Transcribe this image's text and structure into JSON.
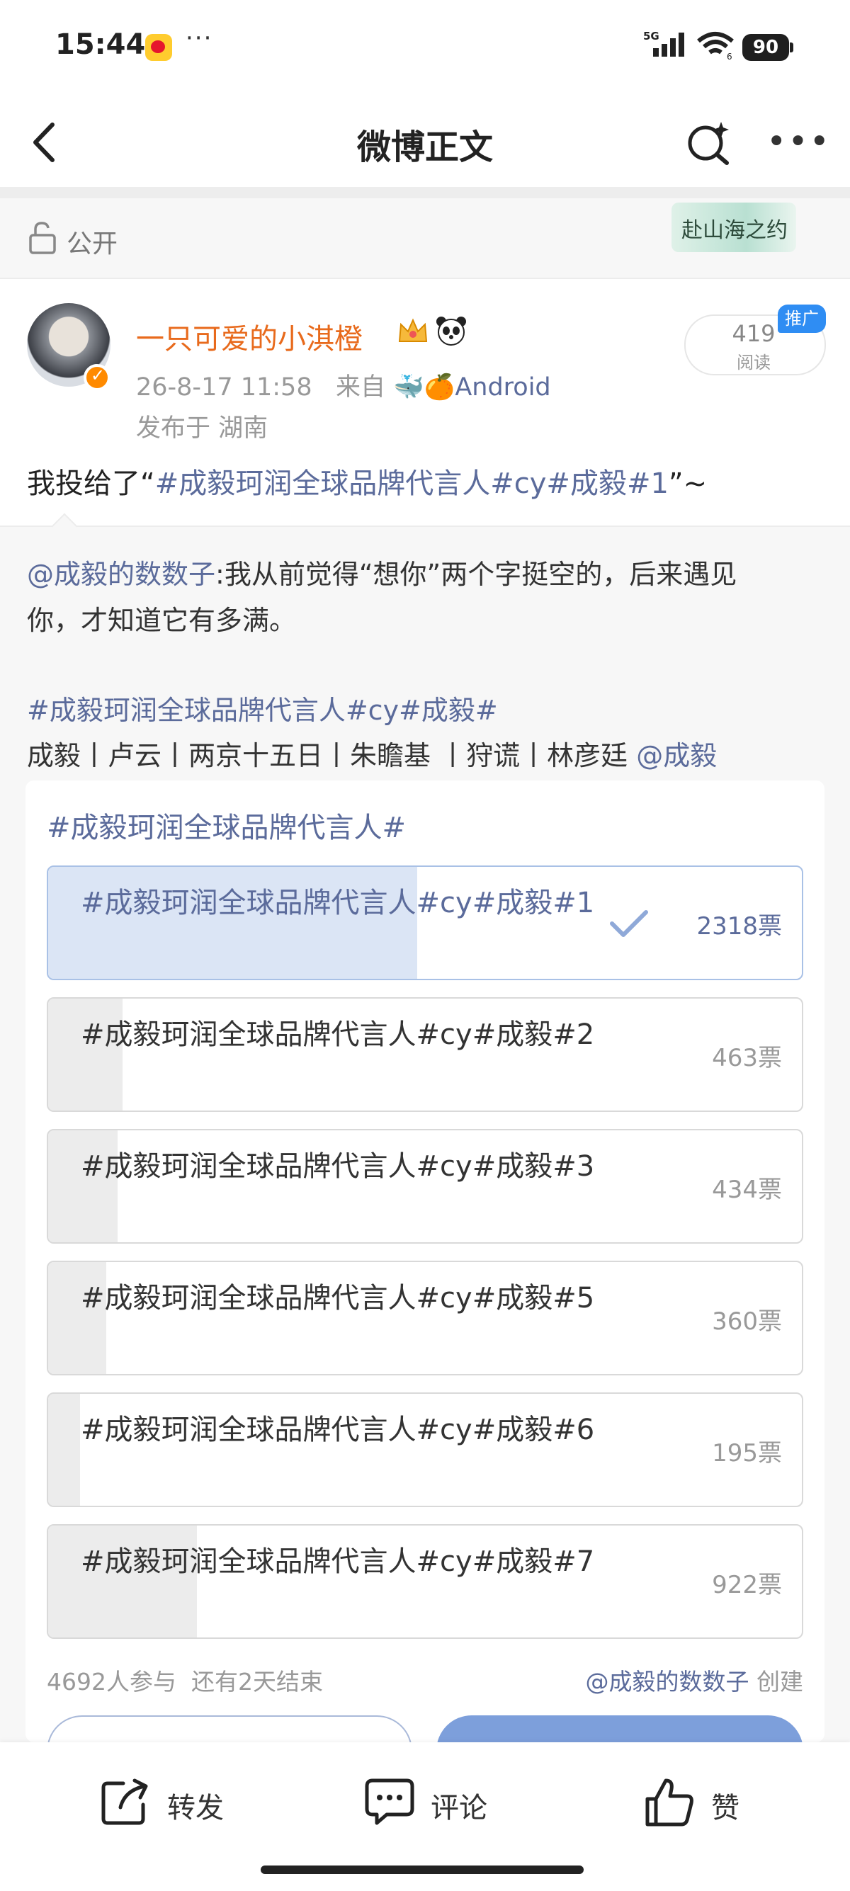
{
  "status_bar": {
    "time": "15:44",
    "dots": "···",
    "network": "5G",
    "wifi_level": "6",
    "battery": "90"
  },
  "nav": {
    "title": "微博正文"
  },
  "visibility": {
    "label": "公开",
    "badge_text": "赴山海之约"
  },
  "post": {
    "username": "一只可爱的小淇橙",
    "date": "26-8-17 11:58",
    "source_prefix": "来自",
    "source": "Android",
    "location": "发布于 湖南",
    "read_count": "419",
    "read_label": "阅读",
    "promo_label": "推广",
    "text_prefix": "我投给了“",
    "text_topic": "#成毅珂润全球品牌代言人#cy#成毅#1",
    "text_suffix": "”~"
  },
  "repost": {
    "author": "@成毅的数数子",
    "body_line1": ":我从前觉得“想你”两个字挺空的，后来遇见",
    "body_line2": "你，才知道它有多满。",
    "tags": "#成毅珂润全球品牌代言人#cy#成毅#",
    "roles": "成毅丨卢云丨两京十五日丨朱瞻基 丨狩谎丨林彦廷",
    "mention": "@成毅"
  },
  "poll": {
    "title": "#成毅珂润全球品牌代言人#",
    "options": [
      {
        "label": "#成毅珂润全球品牌代言人#cy#成毅#1",
        "votes_label": "2318票",
        "share": 0.49,
        "selected": true
      },
      {
        "label": "#成毅珂润全球品牌代言人#cy#成毅#2",
        "votes_label": "463票",
        "share": 0.099,
        "selected": false
      },
      {
        "label": "#成毅珂润全球品牌代言人#cy#成毅#3",
        "votes_label": "434票",
        "share": 0.092,
        "selected": false
      },
      {
        "label": "#成毅珂润全球品牌代言人#cy#成毅#5",
        "votes_label": "360票",
        "share": 0.077,
        "selected": false
      },
      {
        "label": "#成毅珂润全球品牌代言人#cy#成毅#6",
        "votes_label": "195票",
        "share": 0.042,
        "selected": false
      },
      {
        "label": "#成毅珂润全球品牌代言人#cy#成毅#7",
        "votes_label": "922票",
        "share": 0.197,
        "selected": false
      }
    ],
    "participants": "4692人参与",
    "remaining": "还有2天结束",
    "creator": "@成毅的数数子",
    "creator_suffix": "创建"
  },
  "toolbar": {
    "repost": "转发",
    "comment": "评论",
    "like": "赞"
  },
  "colors": {
    "link": "#5b6b9b",
    "username": "#e86a1c",
    "selected_fill": "#dbe5f5",
    "unselected_fill": "#ececec",
    "promo": "#2f8df3"
  },
  "icons": [
    "back-arrow-icon",
    "search-sparkle-icon",
    "more-icon",
    "lock-icon",
    "verified-icon",
    "crown-icon",
    "panda-icon",
    "check-icon",
    "repost-icon",
    "comment-icon",
    "like-icon"
  ]
}
